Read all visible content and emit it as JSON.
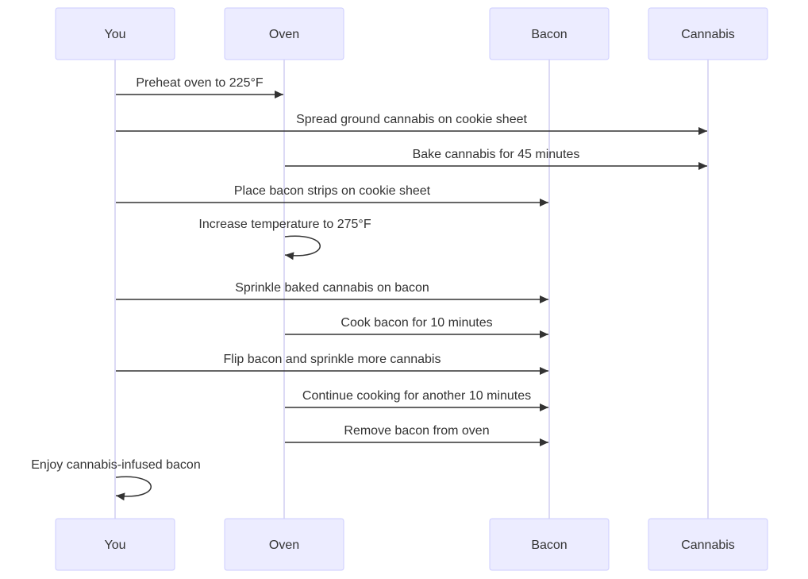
{
  "diagram": {
    "type": "sequence",
    "actors": [
      "You",
      "Oven",
      "Bacon",
      "Cannabis"
    ],
    "messages": [
      {
        "from": "You",
        "to": "Oven",
        "text": "Preheat oven to 225°F"
      },
      {
        "from": "You",
        "to": "Cannabis",
        "text": "Spread ground cannabis on cookie sheet"
      },
      {
        "from": "Oven",
        "to": "Cannabis",
        "text": "Bake cannabis for 45 minutes"
      },
      {
        "from": "You",
        "to": "Bacon",
        "text": "Place bacon strips on cookie sheet"
      },
      {
        "from": "Oven",
        "to": "Oven",
        "text": "Increase temperature to 275°F"
      },
      {
        "from": "You",
        "to": "Bacon",
        "text": "Sprinkle baked cannabis on bacon"
      },
      {
        "from": "Oven",
        "to": "Bacon",
        "text": "Cook bacon for 10 minutes"
      },
      {
        "from": "You",
        "to": "Bacon",
        "text": "Flip bacon and sprinkle more cannabis"
      },
      {
        "from": "Oven",
        "to": "Bacon",
        "text": "Continue cooking for another 10 minutes"
      },
      {
        "from": "Oven",
        "to": "Bacon",
        "text": "Remove bacon from oven"
      },
      {
        "from": "You",
        "to": "You",
        "text": "Enjoy cannabis-infused bacon"
      }
    ],
    "colors": {
      "actor_fill": "#ECECFF",
      "actor_stroke": "#CCCCFF",
      "lifeline": "#DCDAF5",
      "message": "#333333"
    }
  }
}
